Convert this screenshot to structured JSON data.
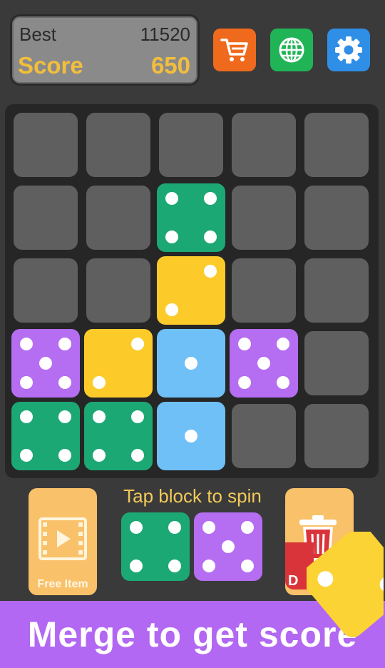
{
  "scores": {
    "best_label": "Best",
    "best_value": "11520",
    "score_label": "Score",
    "score_value": "650"
  },
  "toolbar": {
    "shop_icon": "shopping-cart-icon",
    "language_icon": "globe-icon",
    "settings_icon": "gear-icon"
  },
  "board": {
    "rows": 5,
    "cols": 5,
    "dice": [
      {
        "row": 1,
        "col": 2,
        "face": 4,
        "color": "#1ca874"
      },
      {
        "row": 2,
        "col": 2,
        "face": 2,
        "color": "#fccb2a"
      },
      {
        "row": 3,
        "col": 0,
        "face": 5,
        "color": "#b56df2"
      },
      {
        "row": 3,
        "col": 1,
        "face": 2,
        "color": "#fccb2a"
      },
      {
        "row": 3,
        "col": 2,
        "face": 1,
        "color": "#6fc0f7"
      },
      {
        "row": 3,
        "col": 3,
        "face": 5,
        "color": "#b56df2"
      },
      {
        "row": 4,
        "col": 0,
        "face": 4,
        "color": "#1ca874"
      },
      {
        "row": 4,
        "col": 1,
        "face": 4,
        "color": "#1ca874"
      },
      {
        "row": 4,
        "col": 2,
        "face": 1,
        "color": "#6fc0f7"
      }
    ]
  },
  "next_block": {
    "hint": "Tap block to spin",
    "dice": [
      {
        "face": 4,
        "color": "#1ca874"
      },
      {
        "face": 5,
        "color": "#b56df2"
      }
    ]
  },
  "free_item": {
    "label": "Free Item"
  },
  "delete": {
    "label": "D"
  },
  "banner": {
    "text": "Merge to get score"
  },
  "colors": {
    "background": "#3a3a3a",
    "score_accent": "#f2be3c",
    "banner": "#b268f2"
  }
}
